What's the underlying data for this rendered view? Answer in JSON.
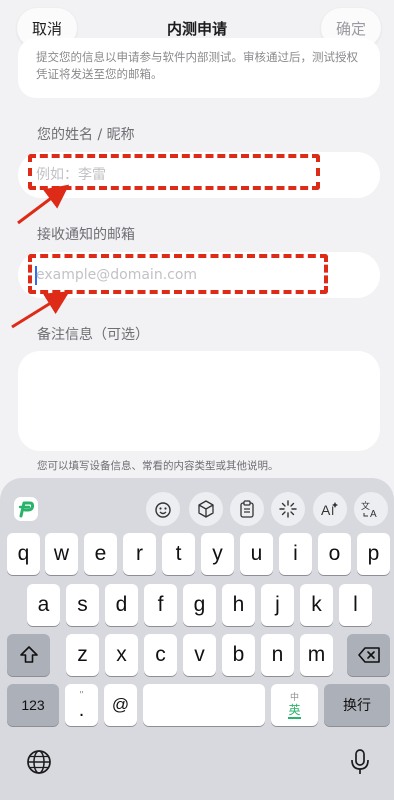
{
  "header": {
    "cancel_label": "取消",
    "title": "内测申请",
    "confirm_label": "确定"
  },
  "intro": {
    "text": "提交您的信息以申请参与软件内部测试。审核通过后，测试授权凭证将发送至您的邮箱。"
  },
  "form": {
    "name_label": "您的姓名 / 昵称",
    "name_placeholder": "例如：李雷",
    "email_label": "接收通知的邮箱",
    "email_placeholder": "example@domain.com",
    "notes_label": "备注信息（可选）",
    "notes_hint": "您可以填写设备信息、常看的内容类型或其他说明。"
  },
  "colors": {
    "annotation": "#de2b17",
    "caret": "#2f6bf3",
    "app_logo": "#29b36a"
  },
  "keyboard": {
    "toolbar_icons": [
      "app-logo-icon",
      "emoji-face-icon",
      "cube-icon",
      "clipboard-icon",
      "sparkle-icon",
      "ai-text-icon",
      "translate-icon"
    ],
    "row1": [
      "q",
      "w",
      "e",
      "r",
      "t",
      "y",
      "u",
      "i",
      "o",
      "p"
    ],
    "row2": [
      "a",
      "s",
      "d",
      "f",
      "g",
      "h",
      "j",
      "k",
      "l"
    ],
    "row3": [
      "z",
      "x",
      "c",
      "v",
      "b",
      "n",
      "m"
    ],
    "num_key": "123",
    "punct_top": "\"",
    "punct_key": ".",
    "at_key": "@",
    "lang_top": "中",
    "lang_bottom": "英",
    "return_key": "换行"
  }
}
